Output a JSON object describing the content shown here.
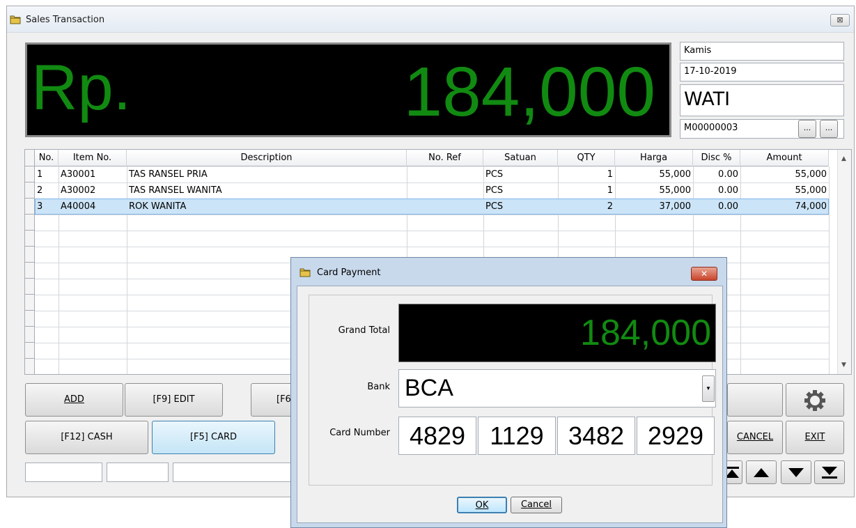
{
  "window": {
    "title": "Sales Transaction",
    "close_label": "⊠"
  },
  "display": {
    "currency": "Rp.",
    "amount": "184,000"
  },
  "info": {
    "day": "Kamis",
    "date": "17-10-2019",
    "cashier": "WATI",
    "member_code": "M00000003",
    "browse1": "...",
    "browse2": "..."
  },
  "grid": {
    "columns": [
      "No.",
      "Item No.",
      "Description",
      "No. Ref",
      "Satuan",
      "QTY",
      "Harga",
      "Disc %",
      "Amount"
    ],
    "rows": [
      [
        "1",
        "A30001",
        "TAS RANSEL PRIA",
        "",
        "PCS",
        "1",
        "55,000",
        "0.00",
        "55,000"
      ],
      [
        "2",
        "A30002",
        "TAS RANSEL WANITA",
        "",
        "PCS",
        "1",
        "55,000",
        "0.00",
        "55,000"
      ],
      [
        "3",
        "A40004",
        "ROK WANITA",
        "",
        "PCS",
        "2",
        "37,000",
        "0.00",
        "74,000"
      ]
    ],
    "selected_row": 3
  },
  "buttons": {
    "add": "ADD",
    "edit": "[F9] EDIT",
    "f6": "[F6",
    "cash": "[F12] CASH",
    "card": "[F5] CARD",
    "cancel": "CANCEL",
    "exit": "EXIT"
  },
  "dialog": {
    "title": "Card Payment",
    "close_label": "✕",
    "grand_total_label": "Grand Total",
    "grand_total": "184,000",
    "bank_label": "Bank",
    "bank": "BCA",
    "card_number_label": "Card Number",
    "card_number": [
      "4829",
      "1129",
      "3482",
      "2929"
    ],
    "ok": "OK",
    "cancel": "Cancel"
  },
  "colors": {
    "display_text": "#118a11",
    "display_bg": "#000000",
    "selected_row": "#cce4f7"
  },
  "icons": [
    "folder-icon",
    "gear-icon",
    "nav-first-icon",
    "nav-up-icon",
    "nav-down-icon",
    "nav-last-icon"
  ]
}
